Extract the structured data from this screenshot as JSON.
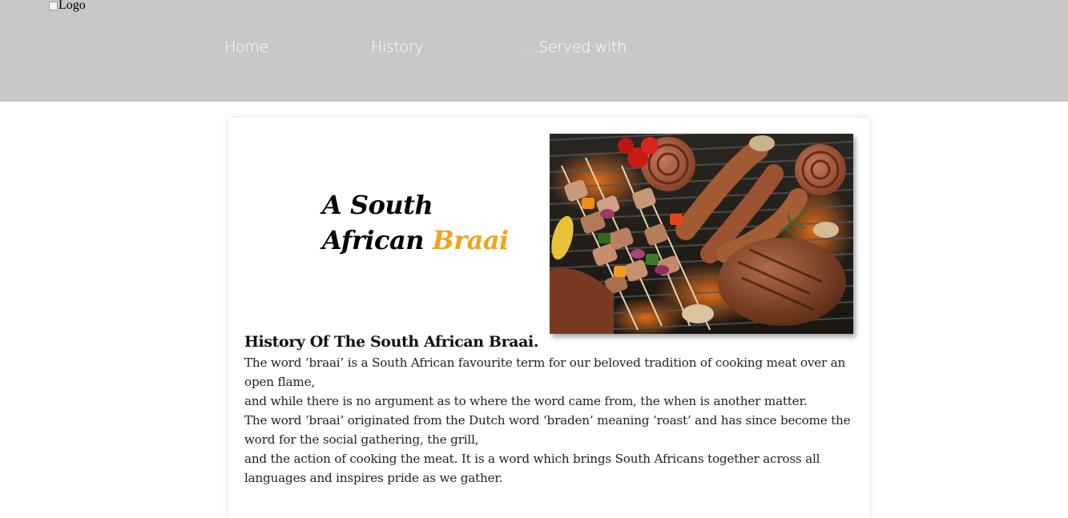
{
  "header": {
    "logo_alt": "Logo",
    "nav": [
      {
        "label": "Home"
      },
      {
        "label": "History"
      },
      {
        "label": "...Served with"
      }
    ]
  },
  "hero": {
    "title_line1": "A South",
    "title_line2_prefix": "African ",
    "title_accent": "Braai",
    "accent_color": "#f2a31b"
  },
  "article": {
    "heading": "History Of The South African Braai.",
    "paragraphs": [
      "The word ‘braai’ is a South African favourite term for our beloved tradition of cooking meat over an open flame,",
      "and while there is no argument as to where the word came from, the when is another matter.",
      "The word ‘braai’ originated from the Dutch word ‘braden’ meaning ‘roast’ and has since become the word for the social gathering, the grill,",
      "and the action of cooking the meat. It is a word which brings South Africans together across all languages and inspires pride as we gather."
    ]
  },
  "colors": {
    "header_bg": "#c8c8c8",
    "nav_text": "#ffffff"
  }
}
